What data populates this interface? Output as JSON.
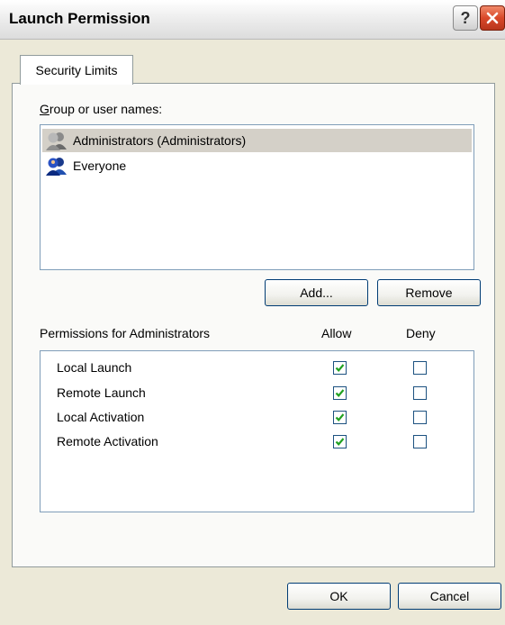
{
  "window": {
    "title": "Launch Permission",
    "help_label": "?",
    "close_label": "✕"
  },
  "tabs": [
    {
      "label": "Security Limits",
      "selected": true
    }
  ],
  "group_section": {
    "label": "Group or user names:",
    "label_access_key": "G",
    "users": [
      {
        "name": "Administrators (Administrators)",
        "icon": "users-group-icon",
        "selected": true
      },
      {
        "name": "Everyone",
        "icon": "users-group-icon",
        "selected": false
      }
    ],
    "add_label": "Add...",
    "remove_label": "Remove"
  },
  "permissions_section": {
    "label": "Permissions for Administrators",
    "allow_header": "Allow",
    "deny_header": "Deny",
    "rows": [
      {
        "name": "Local Launch",
        "allow": true,
        "deny": false
      },
      {
        "name": "Remote Launch",
        "allow": true,
        "deny": false
      },
      {
        "name": "Local Activation",
        "allow": true,
        "deny": false
      },
      {
        "name": "Remote Activation",
        "allow": true,
        "deny": false
      }
    ]
  },
  "footer": {
    "ok_label": "OK",
    "cancel_label": "Cancel"
  },
  "colors": {
    "check_green": "#21a121",
    "selection": "#d4d0c8",
    "face": "#ece9d8"
  }
}
